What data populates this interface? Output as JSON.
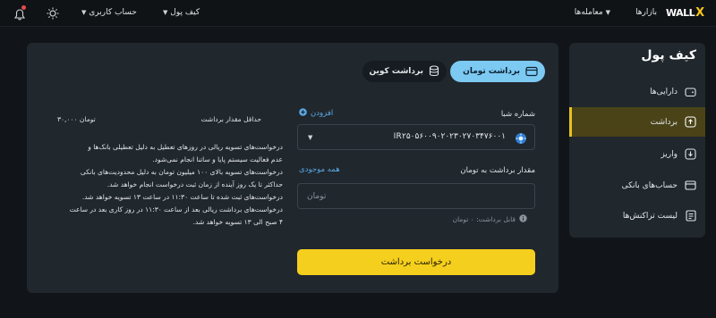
{
  "topbar": {
    "logo_text": "WALL",
    "logo_mark": "X",
    "nav": [
      {
        "label": "بازارها"
      },
      {
        "label": "معامله‌ها"
      }
    ],
    "wallet_menu": "کیف پول",
    "account_menu": "حساب کاربری"
  },
  "sidebar": {
    "title": "کیف پول",
    "items": [
      {
        "label": "دارایی‌ها",
        "icon": "wallet-icon"
      },
      {
        "label": "برداشت",
        "icon": "upload-icon",
        "active": true
      },
      {
        "label": "واریز",
        "icon": "download-icon"
      },
      {
        "label": "حساب‌های بانکی",
        "icon": "card-icon"
      },
      {
        "label": "لیست تراکنش‌ها",
        "icon": "list-icon"
      }
    ]
  },
  "tabs": {
    "toman": "برداشت تومان",
    "coin": "برداشت کوین"
  },
  "form": {
    "sheba_label": "شماره شبا",
    "add_label": "افزودن",
    "sheba_value": "IR۲۵۰۵۶۰۰۹۰۲۰۲۳۰۲۷۰۳۴۷۶۰۰۱",
    "amount_label": "مقدار برداشت به تومان",
    "all_balance": "همه موجودی",
    "amount_placeholder": "تومان",
    "withdrawable": "قابل برداشت: ۰ تومان",
    "submit": "درخواست برداشت"
  },
  "info": {
    "min_label": "حداقل مقدار برداشت",
    "min_value": "۳۰,۰۰۰ تومان",
    "notes": [
      "درخواست‌های تسویه ریالی در روزهای تعطیل به دلیل تعطیلی بانک‌ها و",
      "عدم فعالیت سیستم پایا و ساتنا انجام نمی‌شود.",
      "درخواست‌های تسویه بالای ۱۰۰ میلیون تومان به دلیل محدودیت‌های بانکی",
      "حداکثر تا یک روز آینده از زمان ثبت درخواست انجام خواهد شد.",
      "درخواست‌های ثبت شده تا ساعت ۱۱:۳۰ در ساعت ۱۳ تسویه خواهد شد.",
      "درخواست‌های برداشت ریالی بعد از ساعت ۱۱:۳۰ در روز کاری بعد در ساعت",
      "۴ صبح الی ۱۳ تسویه خواهد شد."
    ]
  },
  "colors": {
    "accent": "#f5cf1e",
    "tab_active": "#7cc9f2",
    "link": "#5aa9e6",
    "notification": "#e84b4b"
  }
}
